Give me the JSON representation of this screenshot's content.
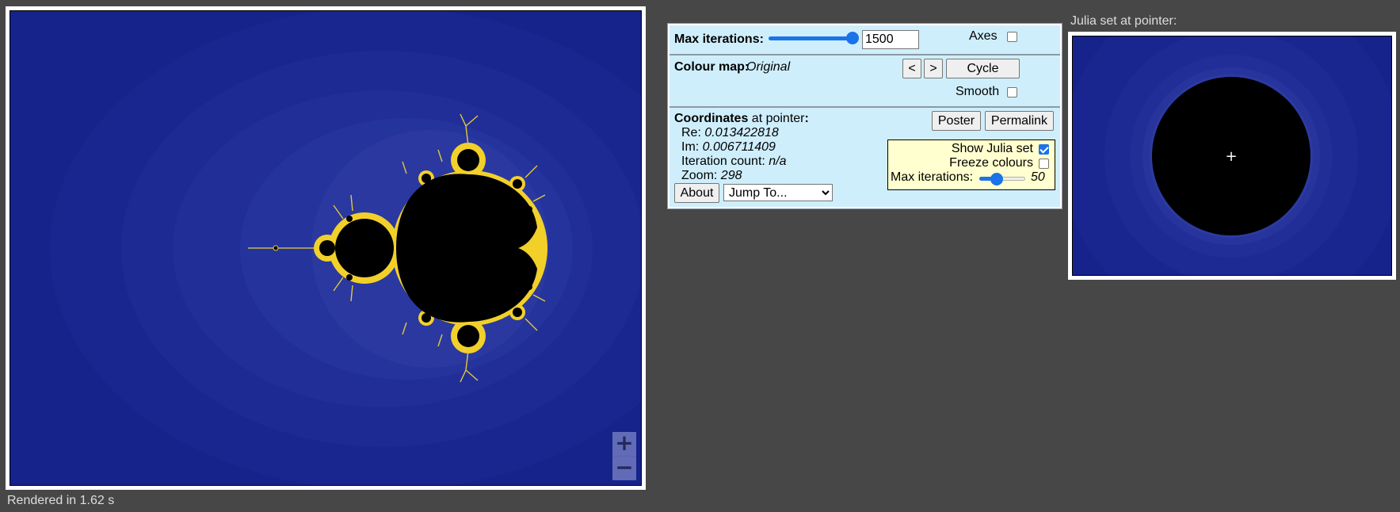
{
  "render_status": "Rendered in 1.62 s",
  "zoom": {
    "in_label": "+",
    "out_label": "−"
  },
  "colors": {
    "background": "#16238a",
    "page": "#474747",
    "panel": "#cfeefc",
    "julia_box": "#ffffcf",
    "accent": "#1a73e8"
  },
  "panel": {
    "max_iterations_label": "Max iterations:",
    "max_iterations_value": "1500",
    "max_iterations_fraction": 1.0,
    "axes_label": "Axes",
    "axes_checked": false,
    "colour_map_label": "Colour map:",
    "colour_map_value": "Original",
    "prev_label": "<",
    "next_label": ">",
    "cycle_label": "Cycle",
    "smooth_label": "Smooth",
    "smooth_checked": false,
    "coordinates_label": "Coordinates",
    "at_pointer": " at pointer",
    "colon": ":",
    "re_label": "Re: ",
    "re_value": "0.013422818",
    "im_label": "Im: ",
    "im_value": "0.006711409",
    "iter_count_label": "Iteration count: ",
    "iter_count_value": "n/a",
    "zoom_label": "Zoom: ",
    "zoom_value": "298",
    "poster_label": "Poster",
    "permalink_label": "Permalink",
    "about_label": "About",
    "jump_to_label": "Jump To...",
    "show_julia_label": "Show Julia set",
    "show_julia_checked": true,
    "freeze_colours_label": "Freeze colours",
    "freeze_colours_checked": false,
    "julia_max_iter_label": "Max iterations:",
    "julia_max_iter_value": "50",
    "julia_max_iter_fraction": 0.35
  },
  "julia": {
    "title": "Julia set at pointer:",
    "crosshair": "+"
  }
}
